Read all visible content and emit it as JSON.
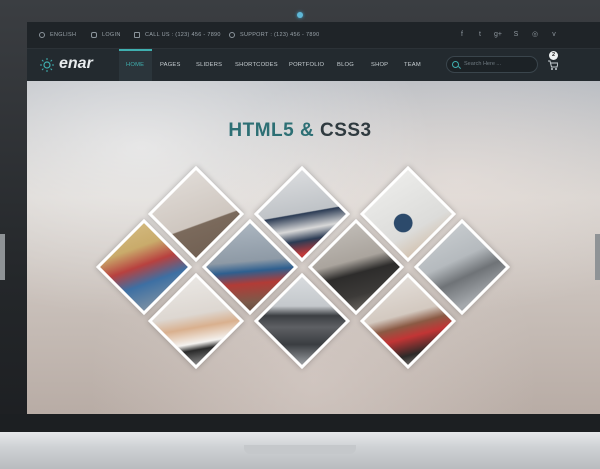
{
  "topbar": {
    "language": "ENGLISH",
    "login": "LOGIN",
    "call": "CALL US : (123) 456 - 7890",
    "support": "SUPPORT : (123) 456 - 7890",
    "social_icons": [
      "facebook-icon",
      "twitter-icon",
      "google-plus-icon",
      "skype-icon",
      "github-icon",
      "vimeo-icon"
    ],
    "social_glyphs": [
      "f",
      "t",
      "g+",
      "S",
      "◎",
      "v"
    ]
  },
  "navbar": {
    "logo": "enar",
    "items": [
      "HOME",
      "PAGES",
      "SLIDERS",
      "SHORTCODES",
      "PORTFOLIO",
      "BLOG",
      "SHOP",
      "TEAM"
    ],
    "active": "HOME",
    "search_placeholder": "Search Here ...",
    "cart_count": "2"
  },
  "hero": {
    "title_part1": "HTML5 &",
    "title_part2": "CSS3",
    "tiles": [
      "cyclist-photo",
      "telescope-girl-photo",
      "sketch-wall-boy-photo",
      "superhero-girl-photo",
      "rooftop-hero-photo",
      "running-businessman-photo",
      "laptop-man-photo",
      "pipe-man-photo",
      "hat-man-photo",
      "phone-woman-photo"
    ]
  },
  "colors": {
    "accent": "#3fb0b0",
    "nav_bg": "#232a2f",
    "topbar_bg": "#1f2428"
  }
}
